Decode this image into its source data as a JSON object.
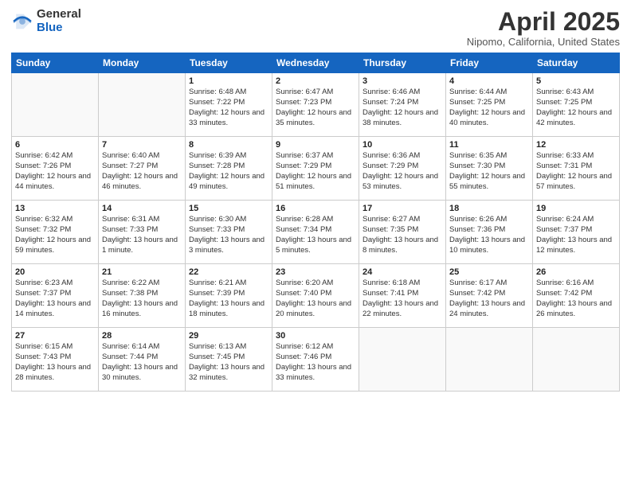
{
  "logo": {
    "general": "General",
    "blue": "Blue"
  },
  "title": "April 2025",
  "subtitle": "Nipomo, California, United States",
  "weekdays": [
    "Sunday",
    "Monday",
    "Tuesday",
    "Wednesday",
    "Thursday",
    "Friday",
    "Saturday"
  ],
  "weeks": [
    [
      {
        "day": "",
        "info": ""
      },
      {
        "day": "",
        "info": ""
      },
      {
        "day": "1",
        "info": "Sunrise: 6:48 AM\nSunset: 7:22 PM\nDaylight: 12 hours and 33 minutes."
      },
      {
        "day": "2",
        "info": "Sunrise: 6:47 AM\nSunset: 7:23 PM\nDaylight: 12 hours and 35 minutes."
      },
      {
        "day": "3",
        "info": "Sunrise: 6:46 AM\nSunset: 7:24 PM\nDaylight: 12 hours and 38 minutes."
      },
      {
        "day": "4",
        "info": "Sunrise: 6:44 AM\nSunset: 7:25 PM\nDaylight: 12 hours and 40 minutes."
      },
      {
        "day": "5",
        "info": "Sunrise: 6:43 AM\nSunset: 7:25 PM\nDaylight: 12 hours and 42 minutes."
      }
    ],
    [
      {
        "day": "6",
        "info": "Sunrise: 6:42 AM\nSunset: 7:26 PM\nDaylight: 12 hours and 44 minutes."
      },
      {
        "day": "7",
        "info": "Sunrise: 6:40 AM\nSunset: 7:27 PM\nDaylight: 12 hours and 46 minutes."
      },
      {
        "day": "8",
        "info": "Sunrise: 6:39 AM\nSunset: 7:28 PM\nDaylight: 12 hours and 49 minutes."
      },
      {
        "day": "9",
        "info": "Sunrise: 6:37 AM\nSunset: 7:29 PM\nDaylight: 12 hours and 51 minutes."
      },
      {
        "day": "10",
        "info": "Sunrise: 6:36 AM\nSunset: 7:29 PM\nDaylight: 12 hours and 53 minutes."
      },
      {
        "day": "11",
        "info": "Sunrise: 6:35 AM\nSunset: 7:30 PM\nDaylight: 12 hours and 55 minutes."
      },
      {
        "day": "12",
        "info": "Sunrise: 6:33 AM\nSunset: 7:31 PM\nDaylight: 12 hours and 57 minutes."
      }
    ],
    [
      {
        "day": "13",
        "info": "Sunrise: 6:32 AM\nSunset: 7:32 PM\nDaylight: 12 hours and 59 minutes."
      },
      {
        "day": "14",
        "info": "Sunrise: 6:31 AM\nSunset: 7:33 PM\nDaylight: 13 hours and 1 minute."
      },
      {
        "day": "15",
        "info": "Sunrise: 6:30 AM\nSunset: 7:33 PM\nDaylight: 13 hours and 3 minutes."
      },
      {
        "day": "16",
        "info": "Sunrise: 6:28 AM\nSunset: 7:34 PM\nDaylight: 13 hours and 5 minutes."
      },
      {
        "day": "17",
        "info": "Sunrise: 6:27 AM\nSunset: 7:35 PM\nDaylight: 13 hours and 8 minutes."
      },
      {
        "day": "18",
        "info": "Sunrise: 6:26 AM\nSunset: 7:36 PM\nDaylight: 13 hours and 10 minutes."
      },
      {
        "day": "19",
        "info": "Sunrise: 6:24 AM\nSunset: 7:37 PM\nDaylight: 13 hours and 12 minutes."
      }
    ],
    [
      {
        "day": "20",
        "info": "Sunrise: 6:23 AM\nSunset: 7:37 PM\nDaylight: 13 hours and 14 minutes."
      },
      {
        "day": "21",
        "info": "Sunrise: 6:22 AM\nSunset: 7:38 PM\nDaylight: 13 hours and 16 minutes."
      },
      {
        "day": "22",
        "info": "Sunrise: 6:21 AM\nSunset: 7:39 PM\nDaylight: 13 hours and 18 minutes."
      },
      {
        "day": "23",
        "info": "Sunrise: 6:20 AM\nSunset: 7:40 PM\nDaylight: 13 hours and 20 minutes."
      },
      {
        "day": "24",
        "info": "Sunrise: 6:18 AM\nSunset: 7:41 PM\nDaylight: 13 hours and 22 minutes."
      },
      {
        "day": "25",
        "info": "Sunrise: 6:17 AM\nSunset: 7:42 PM\nDaylight: 13 hours and 24 minutes."
      },
      {
        "day": "26",
        "info": "Sunrise: 6:16 AM\nSunset: 7:42 PM\nDaylight: 13 hours and 26 minutes."
      }
    ],
    [
      {
        "day": "27",
        "info": "Sunrise: 6:15 AM\nSunset: 7:43 PM\nDaylight: 13 hours and 28 minutes."
      },
      {
        "day": "28",
        "info": "Sunrise: 6:14 AM\nSunset: 7:44 PM\nDaylight: 13 hours and 30 minutes."
      },
      {
        "day": "29",
        "info": "Sunrise: 6:13 AM\nSunset: 7:45 PM\nDaylight: 13 hours and 32 minutes."
      },
      {
        "day": "30",
        "info": "Sunrise: 6:12 AM\nSunset: 7:46 PM\nDaylight: 13 hours and 33 minutes."
      },
      {
        "day": "",
        "info": ""
      },
      {
        "day": "",
        "info": ""
      },
      {
        "day": "",
        "info": ""
      }
    ]
  ]
}
